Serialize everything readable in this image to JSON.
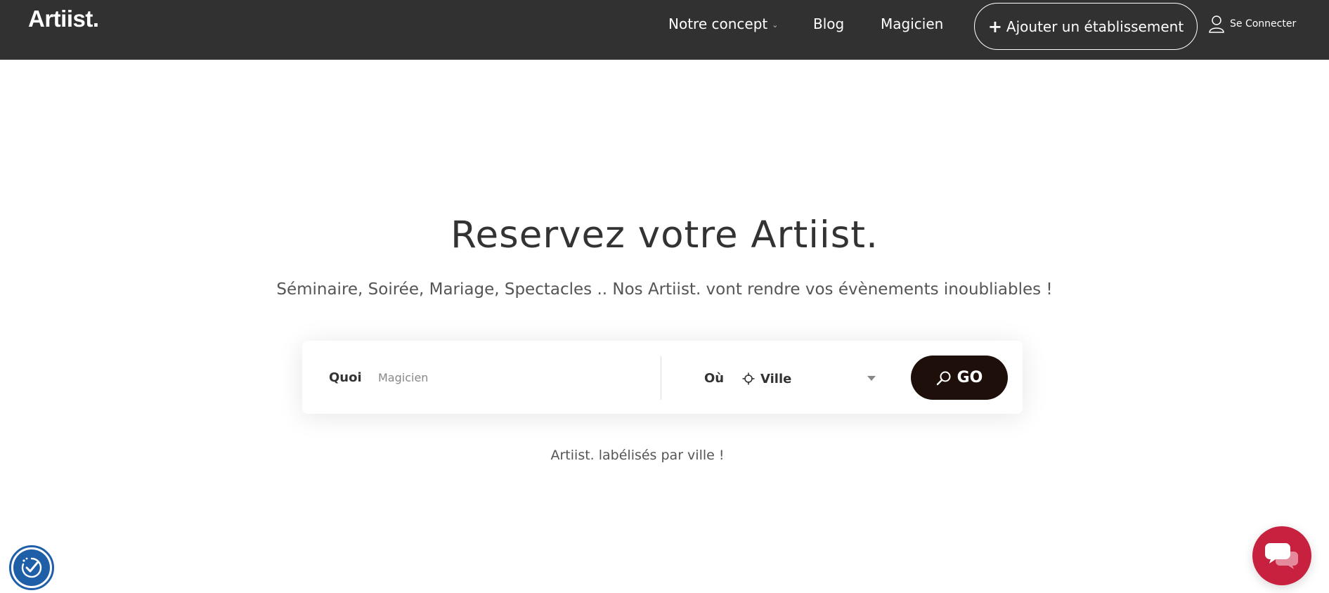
{
  "header": {
    "logo": "Artiist.",
    "nav": {
      "concept": "Notre concept",
      "blog": "Blog",
      "magicien": "Magicien"
    },
    "add_establishment": "Ajouter un établissement",
    "login": "Se Connecter"
  },
  "hero": {
    "title": "Reservez votre Artiist.",
    "subtitle": "Séminaire, Soirée, Mariage, Spectacles .. Nos Artiist. vont rendre vos évènements inoubliables !"
  },
  "search": {
    "what_label": "Quoi",
    "what_placeholder": "Magicien",
    "where_label": "Où",
    "city_value": "Ville",
    "go_label": "GO"
  },
  "tagline": "Artiist. labélisés par ville !",
  "colors": {
    "header_bg": "#313131",
    "go_button": "#1e0f0a",
    "chat_button": "#c8203f",
    "accessibility_button": "#1e5fa8"
  },
  "icons": {
    "nav_concept": "chevron-down-icon",
    "add": "plus-icon",
    "login": "user-icon",
    "city": "crosshair-icon",
    "city_dropdown": "caret-down-icon",
    "go": "search-icon",
    "accessibility": "accessibility-icon",
    "chat": "chat-icon"
  }
}
